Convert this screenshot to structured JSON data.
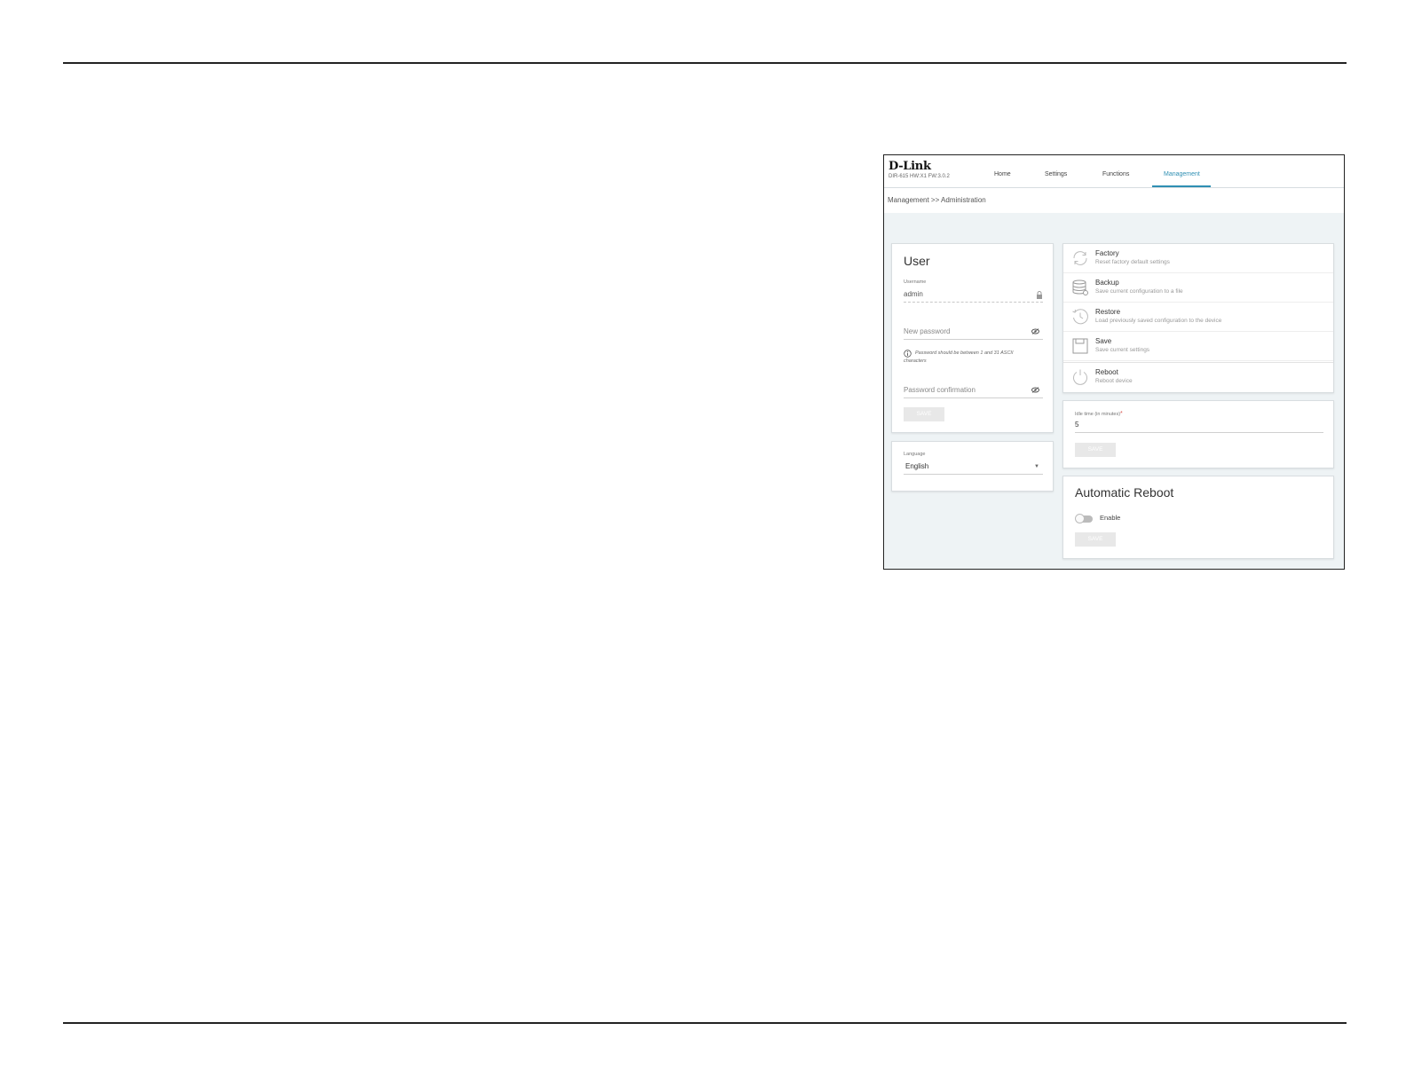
{
  "header": {
    "logo": "D-Link",
    "firmware": "DIR-615 HW:X1 FW:3.0.2",
    "nav": [
      "Home",
      "Settings",
      "Functions",
      "Management"
    ],
    "active_nav": "Management"
  },
  "breadcrumb": "Management >> Administration",
  "user_card": {
    "title": "User",
    "username_label": "Username",
    "username_value": "admin",
    "new_password_placeholder": "New password",
    "password_hint": "Password should be between 1 and 31 ASCII characters",
    "password_confirm_placeholder": "Password confirmation",
    "save_label": "SAVE"
  },
  "language_card": {
    "label": "Language",
    "value": "English"
  },
  "actions": [
    {
      "title": "Factory",
      "subtitle": "Reset factory default settings",
      "icon": "refresh-icon"
    },
    {
      "title": "Backup",
      "subtitle": "Save current configuration to a file",
      "icon": "database-icon"
    },
    {
      "title": "Restore",
      "subtitle": "Load previously saved configuration to the device",
      "icon": "history-icon"
    },
    {
      "title": "Save",
      "subtitle": "Save current settings",
      "icon": "save-icon"
    },
    {
      "title": "Reboot",
      "subtitle": "Reboot device",
      "icon": "power-icon"
    }
  ],
  "idle_card": {
    "label": "Idle time (in minutes)",
    "required_mark": "*",
    "value": "5",
    "save_label": "SAVE"
  },
  "auto_reboot_card": {
    "title": "Automatic Reboot",
    "toggle_label": "Enable",
    "toggle_enabled": false,
    "save_label": "SAVE"
  },
  "colors": {
    "accent": "#2f8fb3",
    "background": "#eef3f5",
    "required": "#d9534f"
  }
}
